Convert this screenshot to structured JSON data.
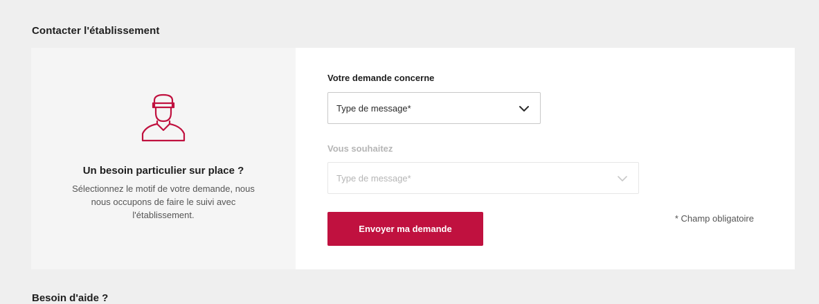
{
  "section": {
    "title": "Contacter l'établissement"
  },
  "left_panel": {
    "icon": "concierge-icon",
    "heading": "Un besoin particulier sur place ?",
    "description_lines": [
      "Sélectionnez le motif de votre demande, nous",
      "nous occupons de faire le suivi avec",
      "l'établissement."
    ]
  },
  "form": {
    "field1": {
      "label": "Votre demande concerne",
      "value": "Type de message*",
      "icon": "chevron-down-icon"
    },
    "field2": {
      "label": "Vous souhaitez",
      "placeholder": "Type de message*",
      "icon": "chevron-down-icon",
      "disabled": true
    },
    "submit_label": "Envoyer ma demande",
    "required_note": "* Champ obligatoire"
  },
  "next_section": {
    "title": "Besoin d'aide ?"
  },
  "colors": {
    "accent": "#c0113f",
    "background": "#efefef",
    "left_panel": "#f5f5f5",
    "right_panel": "#ffffff"
  }
}
